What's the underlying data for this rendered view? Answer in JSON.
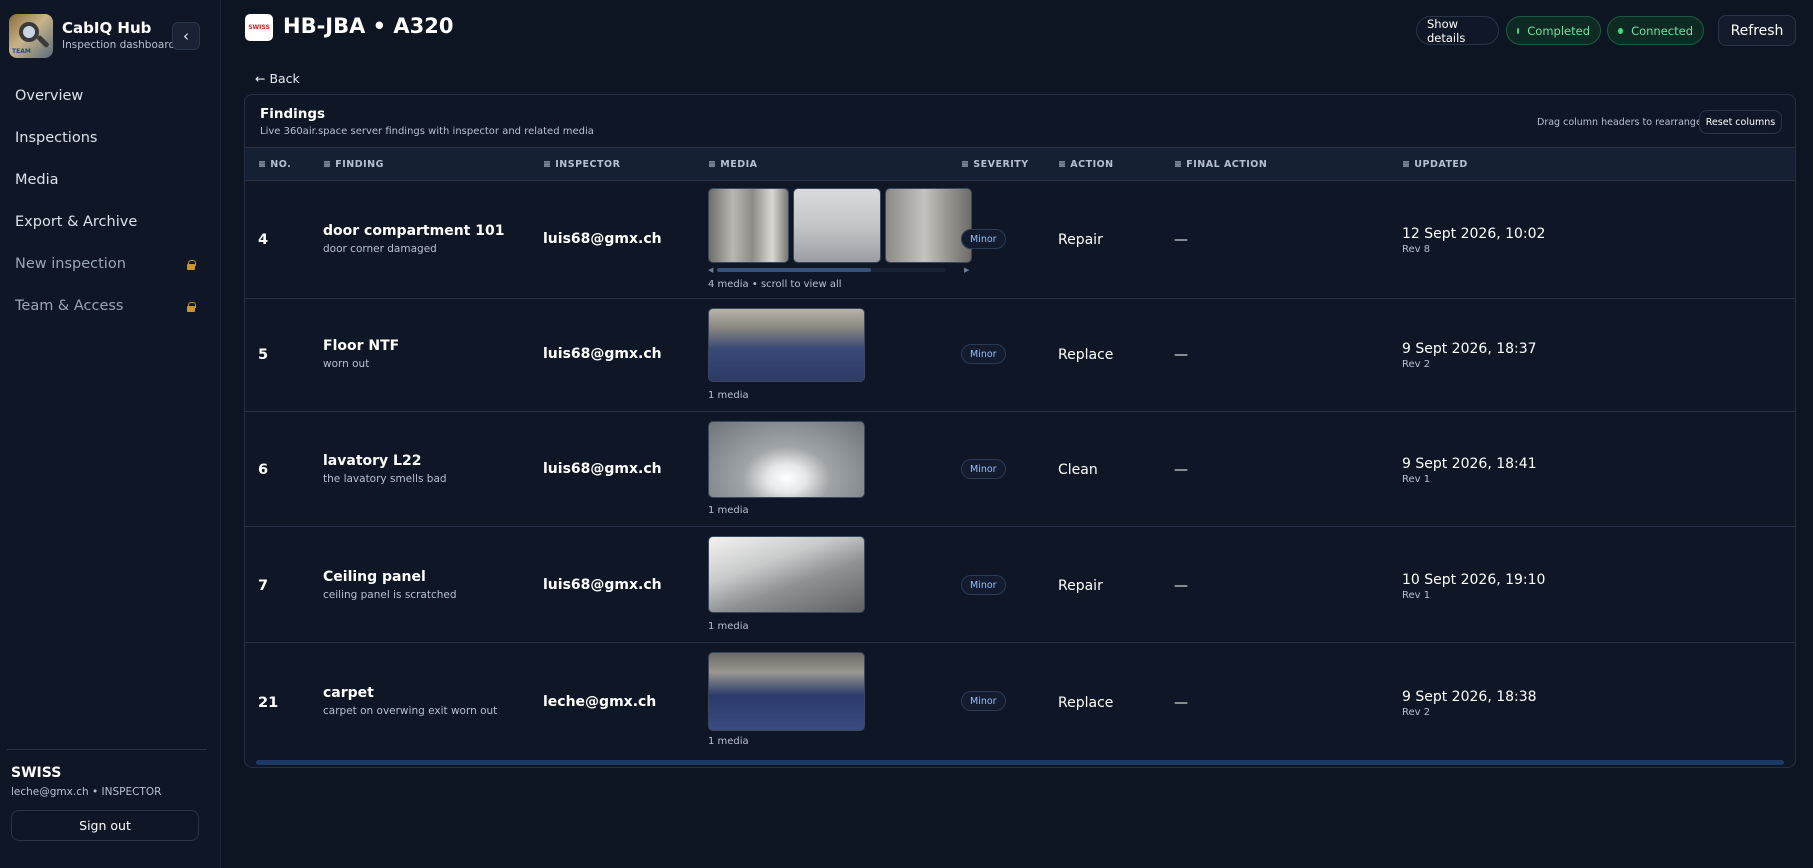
{
  "sidebar": {
    "app_title": "CabIQ Hub",
    "app_subtitle": "Inspection dashboard",
    "logo_tag": "TEAM",
    "collapse_icon": "‹",
    "nav": [
      {
        "label": "Overview",
        "locked": false
      },
      {
        "label": "Inspections",
        "locked": false
      },
      {
        "label": "Media",
        "locked": false
      },
      {
        "label": "Export & Archive",
        "locked": false
      },
      {
        "label": "New inspection",
        "locked": true
      },
      {
        "label": "Team & Access",
        "locked": true
      }
    ],
    "org": "SWISS",
    "user": "leche@gmx.ch • INSPECTOR",
    "signout": "Sign out"
  },
  "header": {
    "badge_text": "SWISS",
    "title": "HB-JBA • A320",
    "show_details": "Show details",
    "status_completed": "Completed",
    "status_connected": "Connected",
    "refresh": "Refresh",
    "back": "← Back"
  },
  "findings": {
    "title": "Findings",
    "subtitle": "Live 360air.space server findings with inspector and related media",
    "drag_hint": "Drag column headers to rearrange",
    "reset_columns": "Reset columns",
    "columns": [
      "≡ NO.",
      "≡ FINDING",
      "≡ INSPECTOR",
      "≡ MEDIA",
      "≡ SEVERITY",
      "≡ ACTION",
      "≡ FINAL ACTION",
      "≡ UPDATED"
    ],
    "rows": [
      {
        "no": "4",
        "title": "door compartment 101",
        "desc": "door corner damaged",
        "inspector": "luis68@gmx.ch",
        "media_caption": "4 media • scroll to view all",
        "severity": "Minor",
        "action": "Repair",
        "final_action": "—",
        "updated": "12 Sept 2026, 10:02",
        "rev": "Rev 8"
      },
      {
        "no": "5",
        "title": "Floor NTF",
        "desc": "worn out",
        "inspector": "luis68@gmx.ch",
        "media_caption": "1 media",
        "severity": "Minor",
        "action": "Replace",
        "final_action": "—",
        "updated": "9 Sept 2026, 18:37",
        "rev": "Rev 2"
      },
      {
        "no": "6",
        "title": "lavatory L22",
        "desc": "the lavatory smells bad",
        "inspector": "luis68@gmx.ch",
        "media_caption": "1 media",
        "severity": "Minor",
        "action": "Clean",
        "final_action": "—",
        "updated": "9 Sept 2026, 18:41",
        "rev": "Rev 1"
      },
      {
        "no": "7",
        "title": "Ceiling panel",
        "desc": "ceiling panel is scratched",
        "inspector": "luis68@gmx.ch",
        "media_caption": "1 media",
        "severity": "Minor",
        "action": "Repair",
        "final_action": "—",
        "updated": "10 Sept 2026, 19:10",
        "rev": "Rev 1"
      },
      {
        "no": "21",
        "title": "carpet",
        "desc": "carpet on overwing exit worn out",
        "inspector": "leche@gmx.ch",
        "media_caption": "1 media",
        "severity": "Minor",
        "action": "Replace",
        "final_action": "—",
        "updated": "9 Sept 2026, 18:38",
        "rev": "Rev 2"
      }
    ]
  },
  "colors": {
    "background": "#0d1422",
    "panel": "#0f1726",
    "accent_green": "#3ddc84",
    "severity_text": "#8fc1ff"
  }
}
